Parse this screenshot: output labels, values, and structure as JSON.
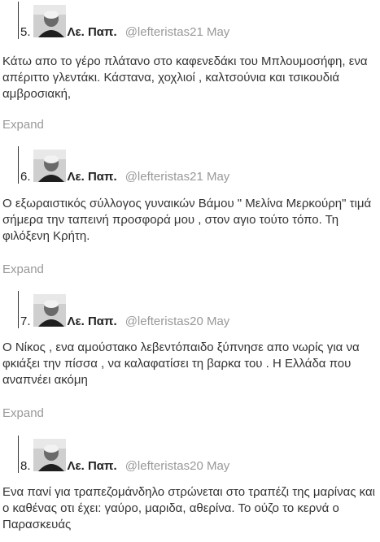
{
  "tweets": [
    {
      "index": "5.",
      "author": "Λε. Παπ.",
      "handle": "@lefteristas",
      "date": "21 May",
      "text": "Κάτω απο το γέρο πλάτανο στο καφενεδάκι του Μπλουμοσήφη, ενα απέριττο γλεντάκι. Κάστανα, χοχλιοί , καλτσούνια και τσικουδιά αμβροσιακή,",
      "expand": "Expand"
    },
    {
      "index": "6.",
      "author": "Λε. Παπ.",
      "handle": "@lefteristas",
      "date": "21 May",
      "text": "Ο εξωραιστικός σύλλογος γυναικών Βάμου \" Μελίνα Μερκούρη\" τιμά σήμερα την ταπεινή προσφορά μου , στον αγιο τούτο τόπο. Τη φιλόξενη Κρήτη.",
      "expand": "Expand"
    },
    {
      "index": "7.",
      "author": "Λε. Παπ.",
      "handle": "@lefteristas",
      "date": "20 May",
      "text": "Ο Νίκος , ενα αμούστακο λεβεντόπαιδο ξύπνησε απο νωρίς για να φκιάξει την πίσσα , να καλαφατίσει τη βαρκα του . Η Ελλάδα που αναπνέει ακόμη",
      "expand": "Expand"
    },
    {
      "index": "8.",
      "author": "Λε. Παπ.",
      "handle": "@lefteristas",
      "date": "20 May",
      "text": "Ενα πανί για τραπεζομάνδηλο στρώνεται στο τραπέζι της μαρίνας και ο καθένας οτι έχει: γαύρο, μαριδα, αθερίνα. Το ούζο το κερνά ο Παρασκευάς",
      "expand": ""
    }
  ]
}
